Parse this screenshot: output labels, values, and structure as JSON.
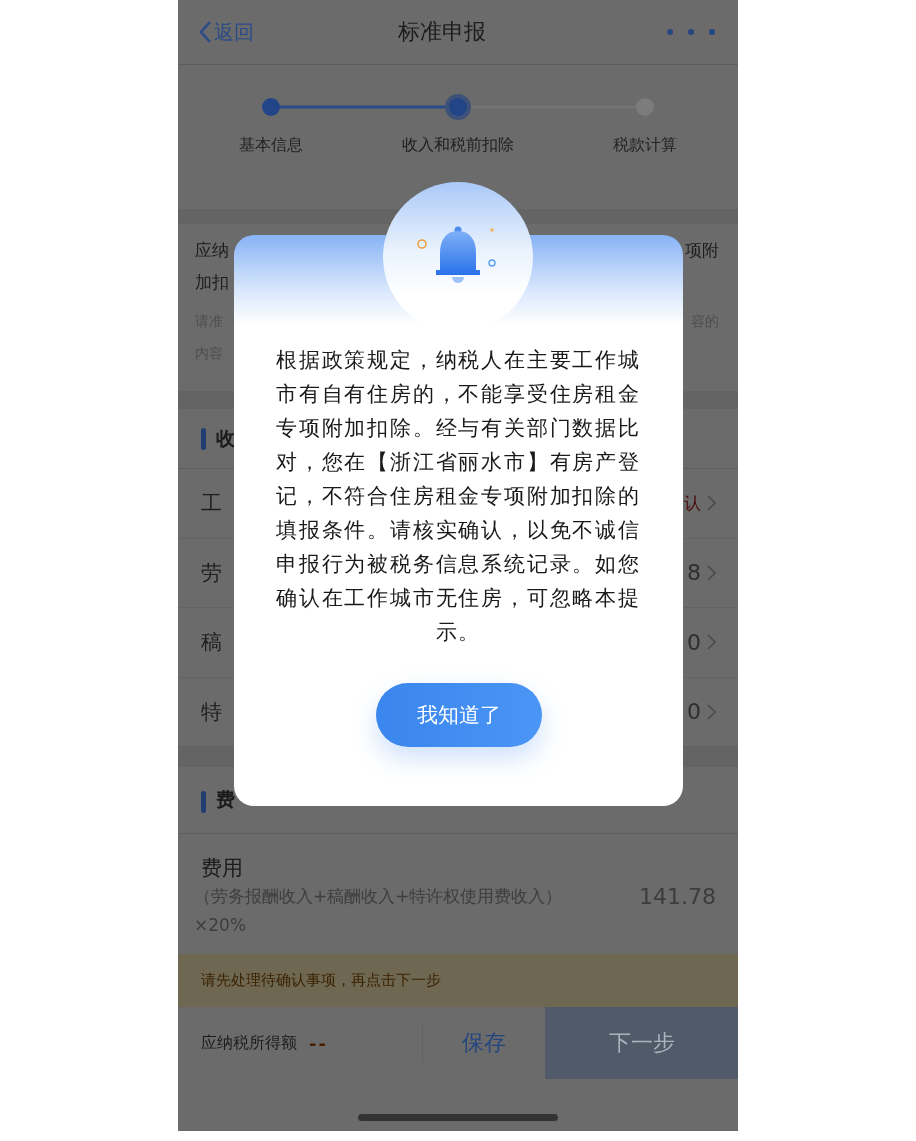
{
  "nav": {
    "back": "返回",
    "title": "标准申报"
  },
  "steps": [
    {
      "label": "基本信息",
      "done": true,
      "selected": false
    },
    {
      "label": "收入和税前扣除",
      "done": true,
      "selected": true
    },
    {
      "label": "税款计算",
      "done": false,
      "selected": false
    }
  ],
  "notice": [
    {
      "kind": "title",
      "left": "应纳",
      "right": "项附"
    },
    {
      "kind": "title",
      "left": "加扣"
    },
    {
      "kind": "hint",
      "left": "请准",
      "right": "容的"
    },
    {
      "kind": "hint",
      "left": "内容"
    }
  ],
  "income": {
    "header": "收",
    "rows": [
      {
        "label": "工",
        "value": "认",
        "kind": "status"
      },
      {
        "label": "劳",
        "value": "8",
        "kind": "amount"
      },
      {
        "label": "稿",
        "value": "0",
        "kind": "amount"
      },
      {
        "label": "特",
        "value": "0",
        "kind": "amount"
      }
    ]
  },
  "expenses": {
    "header": "费",
    "item": {
      "label": "费用",
      "formula": "（劳务报酬收入+稿酬收入+特许权使用费收入）×20%",
      "amount": "141.78"
    }
  },
  "warning": "请先处理待确认事项，再点击下一步",
  "footer": {
    "label": "应纳税所得额",
    "value": "--",
    "save": "保存",
    "next": "下一步",
    "next_disabled": true
  },
  "dialog": {
    "message": "根据政策规定，纳税人在主要工作城市有自有住房的，不能享受住房租金专项附加扣除。经与有关部门数据比对，您在【浙江省丽水市】有房产登记，不符合住房租金专项附加扣除的填报条件。请核实确认，以免不诚信申报行为被税务信息系统记录。如您确认在工作城市无住房，可忽略本提示。",
    "button": "我知道了"
  }
}
